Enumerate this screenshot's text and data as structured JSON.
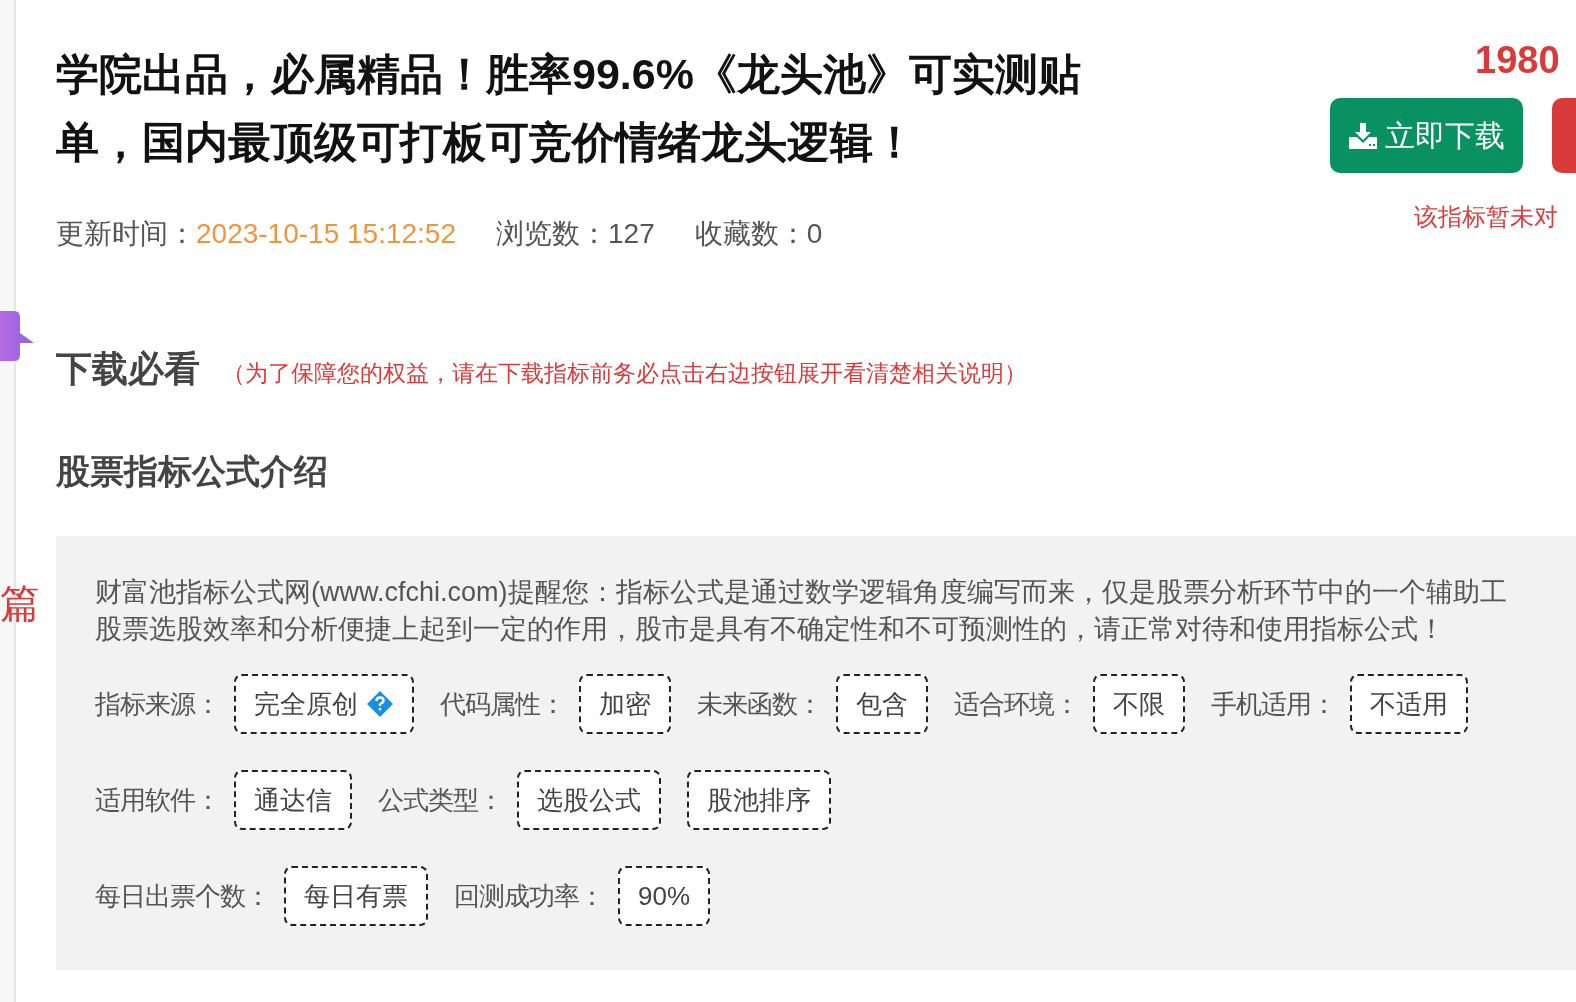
{
  "side": {
    "mark": "篇"
  },
  "title": [
    "学院出品，必属精品！胜率99.6%《龙头池》可实测贴",
    "单，国内最顶级可打板可竞价情绪龙头逻辑！"
  ],
  "meta": [
    {
      "label": "更新时间：",
      "value": "2023-10-15 15:12:52",
      "highlight": true
    },
    {
      "label": "浏览数：",
      "value": "127"
    },
    {
      "label": "收藏数：",
      "value": "0"
    }
  ],
  "price": "1980",
  "download_button": "立即下载",
  "notice": "该指标暂未对",
  "must_read": {
    "heading": "下载必看",
    "note": "（为了保障您的权益，请在下载指标前务必点击右边按钮展开看清楚相关说明）"
  },
  "intro": {
    "heading": "股票指标公式介绍",
    "paragraph": [
      "财富池指标公式网(www.cfchi.com)提醒您：指标公式是通过数学逻辑角度编写而来，仅是股票分析环节中的一个辅助工",
      "股票选股效率和分析便捷上起到一定的作用，股市是具有不确定性和不可预测性的，请正常对待和使用指标公式！"
    ],
    "rows": [
      [
        {
          "label": "指标来源：",
          "value": "完全原创",
          "help": true
        },
        {
          "label": "代码属性：",
          "value": "加密"
        },
        {
          "label": "未来函数：",
          "value": "包含"
        },
        {
          "label": "适合环境：",
          "value": "不限"
        },
        {
          "label": "手机适用：",
          "value": "不适用"
        }
      ],
      [
        {
          "label": "适用软件：",
          "value": "通达信"
        },
        {
          "label": "公式类型：",
          "value": "选股公式"
        },
        {
          "value": "股池排序"
        }
      ],
      [
        {
          "label": "每日出票个数：",
          "value": "每日有票"
        },
        {
          "label": "回测成功率：",
          "value": "90%"
        }
      ]
    ]
  }
}
